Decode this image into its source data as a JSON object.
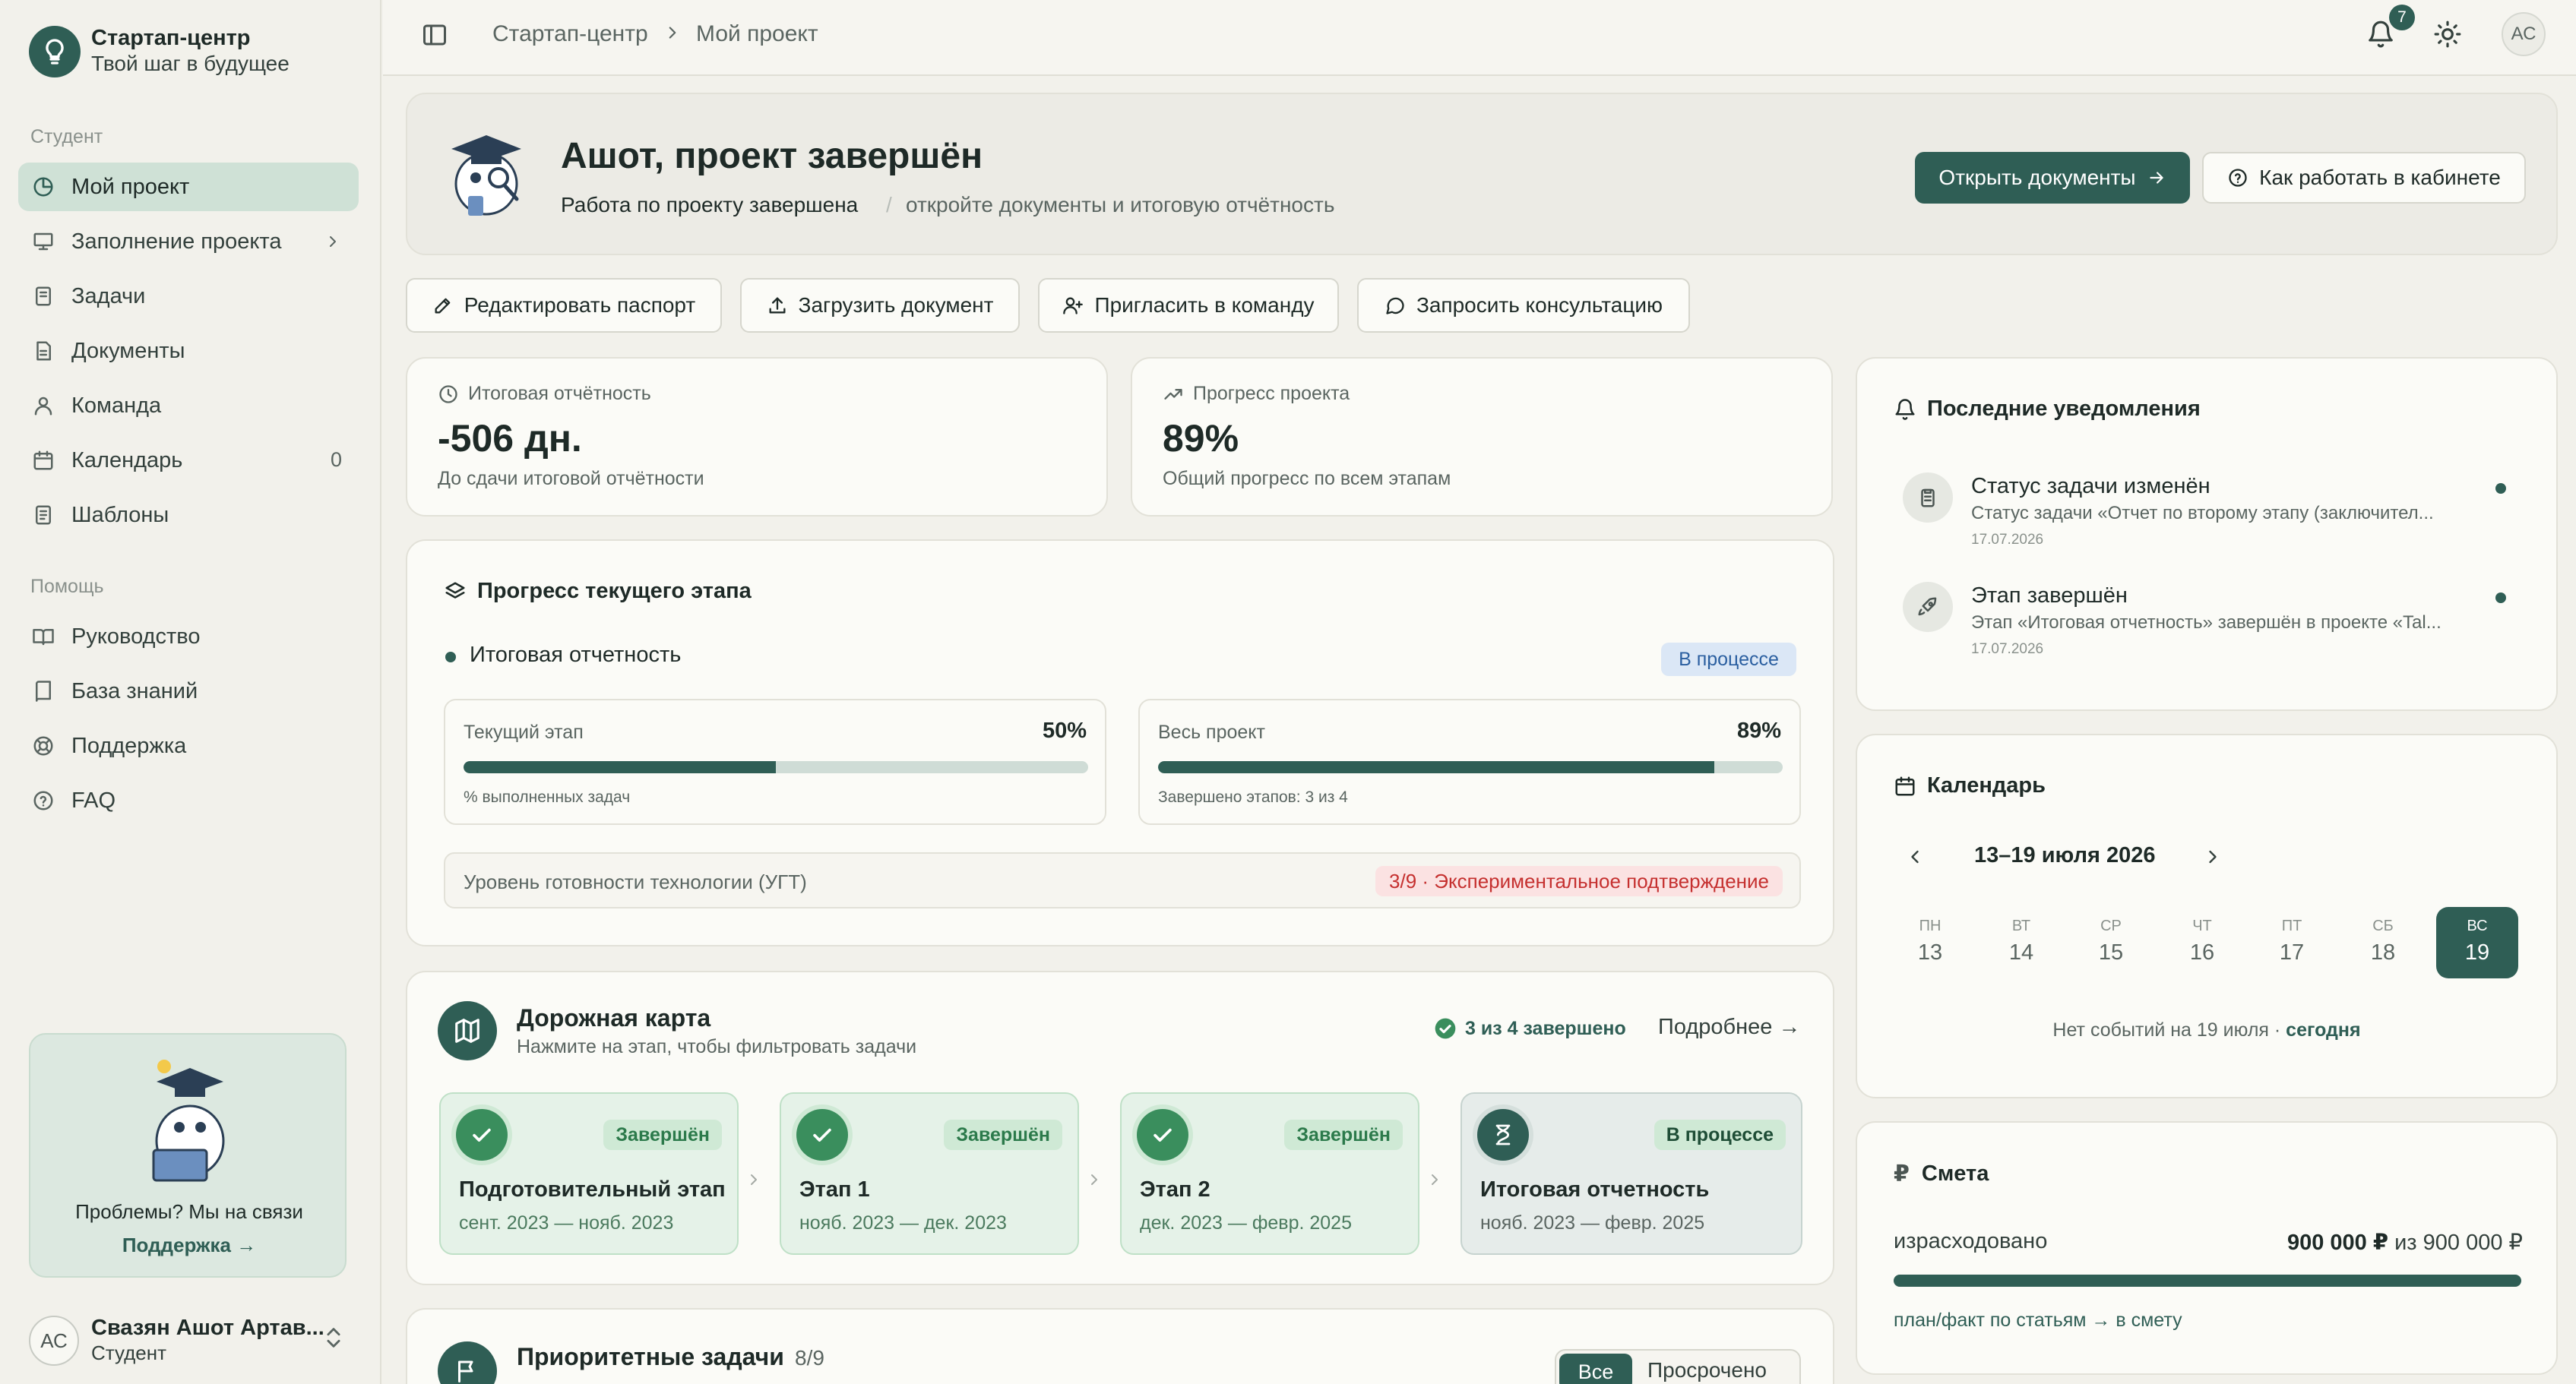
{
  "brand": {
    "title": "Стартап-центр",
    "subtitle": "Твой шаг в будущее"
  },
  "sidebar": {
    "section_student": "Студент",
    "items": [
      {
        "label": "Мой проект",
        "icon": "pie-chart-icon",
        "active": true
      },
      {
        "label": "Заполнение проекта",
        "icon": "presentation-icon",
        "has_submenu": true
      },
      {
        "label": "Задачи",
        "icon": "notebook-icon"
      },
      {
        "label": "Документы",
        "icon": "document-icon"
      },
      {
        "label": "Команда",
        "icon": "user-icon"
      },
      {
        "label": "Календарь",
        "icon": "calendar-icon",
        "count": "0"
      },
      {
        "label": "Шаблоны",
        "icon": "file-text-icon"
      }
    ],
    "section_help": "Помощь",
    "help_items": [
      {
        "label": "Руководство",
        "icon": "book-open-icon"
      },
      {
        "label": "База знаний",
        "icon": "book-icon"
      },
      {
        "label": "Поддержка",
        "icon": "lifebuoy-icon"
      },
      {
        "label": "FAQ",
        "icon": "help-circle-icon"
      }
    ],
    "help_card": {
      "text": "Проблемы? Мы на связи",
      "link": "Поддержка →"
    },
    "user": {
      "initials": "АС",
      "name": "Свазян Ашот Артав...",
      "role": "Студент"
    }
  },
  "topbar": {
    "breadcrumb": [
      "Стартап-центр",
      "Мой проект"
    ],
    "notifications_count": "7",
    "avatar_initials": "АС"
  },
  "hero": {
    "title": "Ашот, проект завершён",
    "status": "Работа по проекту завершена",
    "separator": "/",
    "hint": "откройте документы и итоговую отчётность",
    "primary_button": "Открыть документы",
    "secondary_button": "Как работать в кабинете"
  },
  "quick_actions": [
    {
      "label": "Редактировать паспорт",
      "icon": "edit-icon"
    },
    {
      "label": "Загрузить документ",
      "icon": "upload-icon"
    },
    {
      "label": "Пригласить в команду",
      "icon": "user-plus-icon"
    },
    {
      "label": "Запросить консультацию",
      "icon": "message-circle-icon"
    }
  ],
  "stats": [
    {
      "label": "Итоговая отчётность",
      "value": "-506 дн.",
      "sub": "До сдачи итоговой отчётности",
      "icon": "clock-icon"
    },
    {
      "label": "Прогресс проекта",
      "value": "89%",
      "sub": "Общий прогресс по всем этапам",
      "icon": "trending-up-icon"
    }
  ],
  "current_stage": {
    "title": "Прогресс текущего этапа",
    "stage_name": "Итоговая отчетность",
    "badge": "В процессе",
    "current": {
      "label": "Текущий этап",
      "value": "50%",
      "progress": 0.5,
      "note": "% выполненных задач"
    },
    "project": {
      "label": "Весь проект",
      "value": "89%",
      "progress": 0.89,
      "note": "Завершено этапов: 3 из 4"
    },
    "trl": {
      "label": "Уровень готовности технологии (УГТ)",
      "badge": "3/9 · Экспериментальное подтверждение"
    }
  },
  "roadmap": {
    "title": "Дорожная карта",
    "subtitle": "Нажмите на этап, чтобы фильтровать задачи",
    "done": "3 из 4 завершено",
    "more": "Подробнее →",
    "stages": [
      {
        "status": "Завершён",
        "name": "Подготовительный этап",
        "dates": "сент. 2023 — нояб. 2023",
        "current": false
      },
      {
        "status": "Завершён",
        "name": "Этап 1",
        "dates": "нояб. 2023 — дек. 2023",
        "current": false
      },
      {
        "status": "Завершён",
        "name": "Этап 2",
        "dates": "дек. 2023 — февр. 2025",
        "current": false
      },
      {
        "status": "В процессе",
        "name": "Итоговая отчетность",
        "dates": "нояб. 2023 — февр. 2025",
        "current": true
      }
    ]
  },
  "priority": {
    "title": "Приоритетные задачи",
    "count": "8/9",
    "filter_all": "Все",
    "filter_overdue": "Просрочено"
  },
  "notifications": {
    "title": "Последние уведомления",
    "items": [
      {
        "title": "Статус задачи изменён",
        "text": "Статус задачи «Отчет по второму этапу (заключител...",
        "date": "17.07.2026",
        "icon": "clipboard-icon"
      },
      {
        "title": "Этап завершён",
        "text": "Этап «Итоговая отчетность» завершён в проекте «Tal...",
        "date": "17.07.2026",
        "icon": "rocket-icon"
      }
    ]
  },
  "calendar": {
    "title": "Календарь",
    "range": "13–19 июля 2026",
    "days": [
      {
        "name": "ПН",
        "date": "13"
      },
      {
        "name": "ВТ",
        "date": "14"
      },
      {
        "name": "СР",
        "date": "15"
      },
      {
        "name": "ЧТ",
        "date": "16"
      },
      {
        "name": "ПТ",
        "date": "17"
      },
      {
        "name": "СБ",
        "date": "18"
      },
      {
        "name": "ВС",
        "date": "19",
        "selected": true
      }
    ],
    "note": "Нет событий на 19 июля · ",
    "today": "сегодня"
  },
  "budget": {
    "title": "Смета",
    "currency_icon": "ruble-icon",
    "spent_label": "израсходовано",
    "spent": "900 000 ₽",
    "of": "из 900 000 ₽",
    "progress": 1.0,
    "link": "план/факт по статьям → в смету"
  }
}
